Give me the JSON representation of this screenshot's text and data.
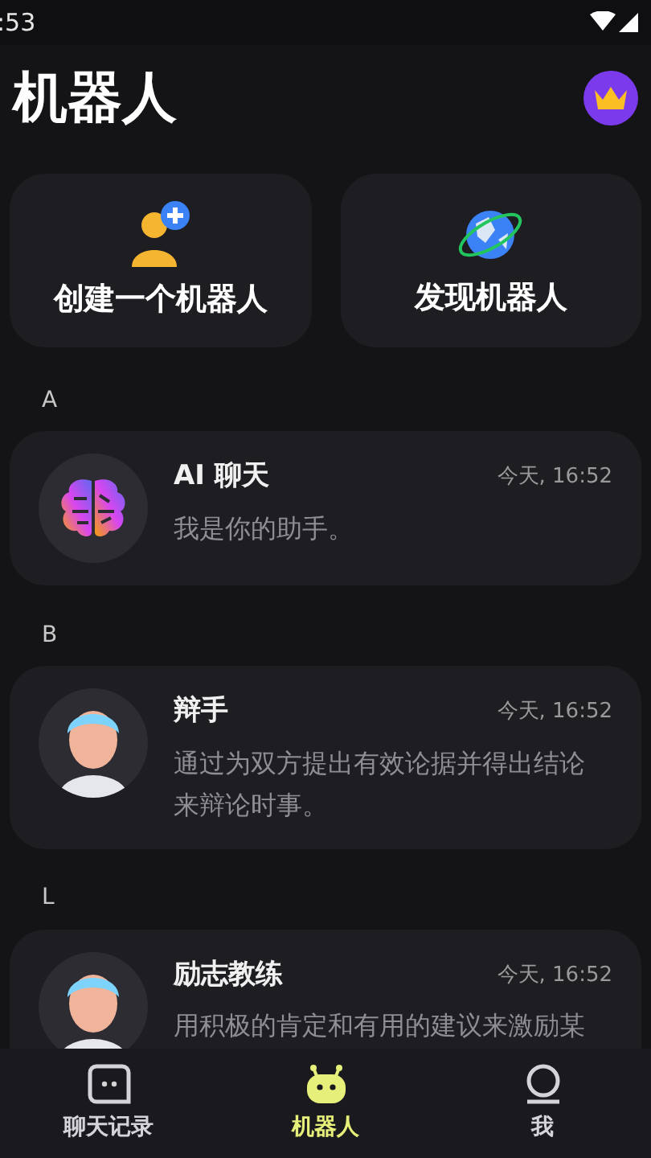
{
  "status_bar": {
    "time": ":53"
  },
  "header": {
    "title": "机器人"
  },
  "actions": [
    {
      "kind": "create",
      "label": "创建一个机器人"
    },
    {
      "kind": "discover",
      "label": "发现机器人"
    }
  ],
  "sections": [
    {
      "letter": "A",
      "bots": [
        {
          "kind": "brain",
          "name": "AI 聊天",
          "time": "今天, 16:52",
          "description": "我是你的助手。"
        }
      ]
    },
    {
      "letter": "B",
      "bots": [
        {
          "kind": "person",
          "name": "辩手",
          "time": "今天, 16:52",
          "description": "通过为双方提出有效论据并得出结论来辩论时事。"
        }
      ]
    },
    {
      "letter": "L",
      "bots": [
        {
          "kind": "person",
          "name": "励志教练",
          "time": "今天, 16:52",
          "description": "用积极的肯定和有用的建议来激励某"
        }
      ]
    }
  ],
  "nav": [
    {
      "kind": "chat",
      "label": "聊天记录",
      "selected": false
    },
    {
      "kind": "robot",
      "label": "机器人",
      "selected": true
    },
    {
      "kind": "me",
      "label": "我",
      "selected": false
    }
  ]
}
